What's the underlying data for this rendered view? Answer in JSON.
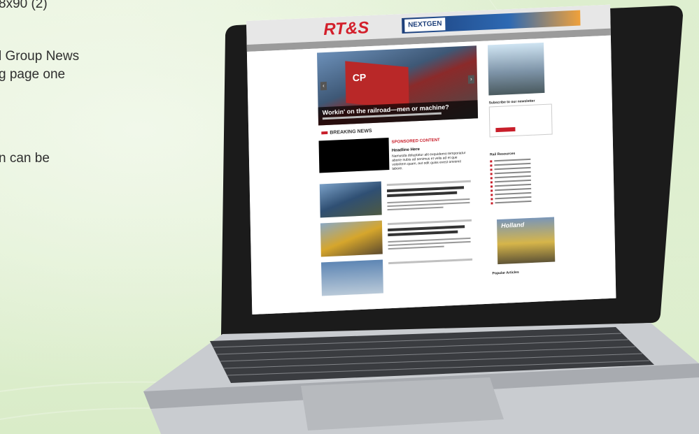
{
  "left_text": {
    "line1": "8x90 (2)",
    "line2": "l Group News",
    "line3": "g page one",
    "line4": "n can be"
  },
  "site": {
    "logo": "RT&S",
    "banner_brand": "NEXTGEN",
    "hero_badge": "CP",
    "hero_caption": "Workin' on the railroad—men or machine?",
    "breaking_news": "BREAKING NEWS",
    "sponsored_label": "SPONSORED CONTENT",
    "sponsored_heading": "Headline Here",
    "sponsored_text": "Namusda doluptatur alit exquidemo temporiatur aborie nubis ad senimus et velis ad et que voloritem quam, aut odit quiss evest omnimil labore.",
    "subscribe_heading": "Subscribe to our newsletter",
    "rail_list_heading": "Rail Resources",
    "holland_ad": "Holland",
    "popular_heading": "Popular Articles"
  },
  "colors": {
    "background": "#e8f3dc",
    "brand_red": "#d31f2b",
    "laptop_bezel": "#1b1b1b",
    "laptop_body": "#c9ccd0"
  }
}
